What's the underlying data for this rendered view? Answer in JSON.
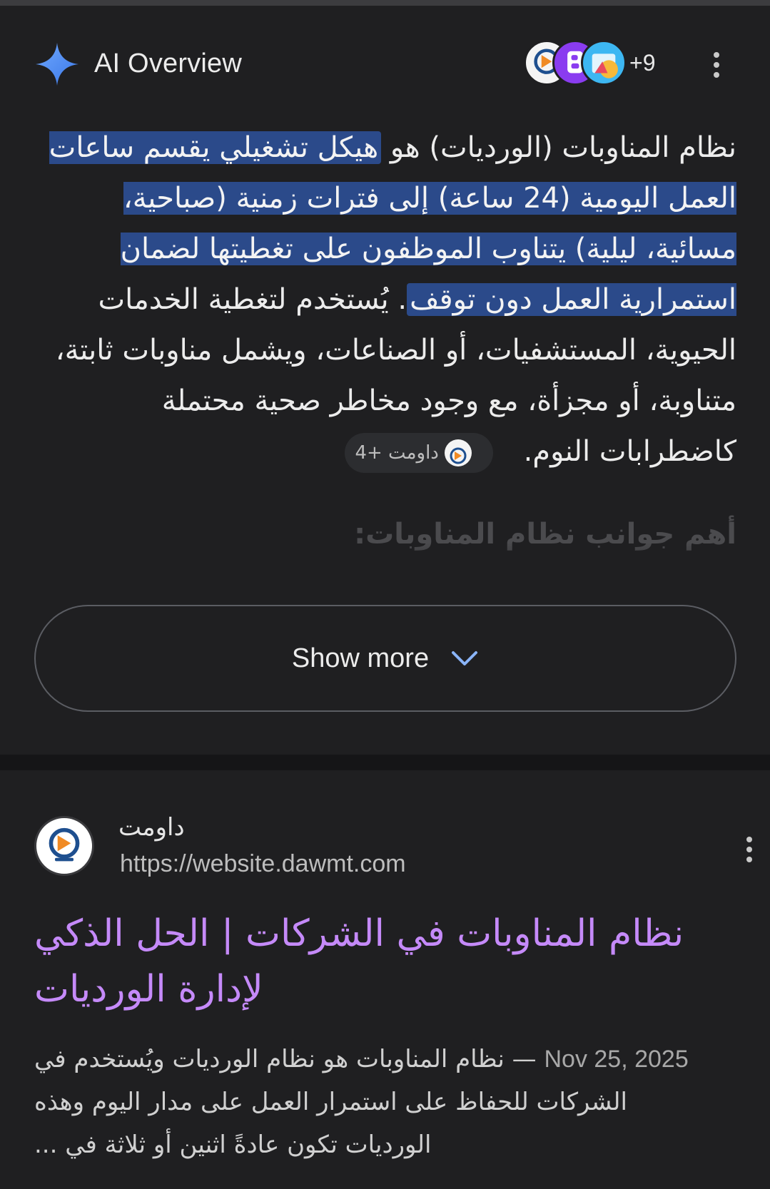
{
  "ai_overview": {
    "title": "AI Overview",
    "extra_sources": "+9",
    "text_plain_1": "نظام المناوبات (الورديات) هو ",
    "text_highlight_1": "هيكل تشغيلي يقسم ساعات العمل اليومية (24 ساعة) إلى فترات زمنية (صباحية، مسائية، ليلية) يتناوب الموظفون على تغطيتها لضمان استمرارية العمل دون توقف",
    "text_plain_2": ". يُستخدم لتغطية الخدمات الحيوية، المستشفيات، أو الصناعات، ويشمل مناوبات ثابتة، متناوبة، أو مجزأة، مع وجود مخاطر صحية محتملة كاضطرابات النوم.",
    "citation_label": "داومت +4",
    "faded_heading": "أهم جوانب نظام المناوبات:",
    "show_more_label": "Show more"
  },
  "result": {
    "site_name": "داومت",
    "url": "https://website.dawmt.com",
    "title": "نظام المناوبات في الشركات | الحل الذكي لإدارة الورديات",
    "date": "Nov 25, 2025",
    "snippet": " — نظام المناوبات هو نظام الورديات ويُستخدم في الشركات للحفاظ على استمرار العمل على مدار اليوم وهذه الورديات تكون عادةً اثنين أو ثلاثة في ..."
  },
  "colors": {
    "background": "#1f1f21",
    "highlight": "#2b4a8a",
    "link_title": "#c58af9",
    "sparkle": "#4f8cf7"
  },
  "icons": [
    "sparkle-icon",
    "source-favicon",
    "more-vert-icon",
    "chevron-down-icon",
    "site-logo"
  ]
}
